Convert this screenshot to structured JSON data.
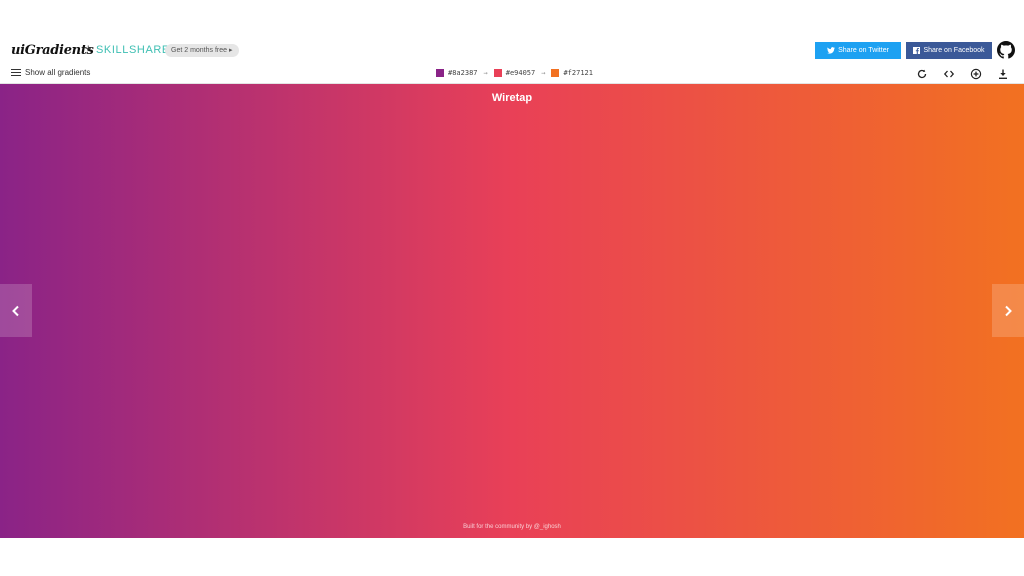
{
  "header": {
    "logo": "uiGradients",
    "plus": "+",
    "partner": "SKILLSHARE",
    "promo": "Get 2 months free",
    "twitter": "Share on Twitter",
    "facebook": "Share on Facebook"
  },
  "toolbar": {
    "show_all": "Show all gradients",
    "colors": [
      "#8a2387",
      "#e94057",
      "#f27121"
    ],
    "arrow": "→"
  },
  "gradient": {
    "name": "Wiretap",
    "credit": "Built for the community by @_ighosh"
  },
  "icons": {
    "menu": "hamburger-icon",
    "rotate": "rotate-icon",
    "code": "code-icon",
    "add": "add-icon",
    "download": "download-icon",
    "github": "github-icon",
    "prev": "chevron-left-icon",
    "next": "chevron-right-icon"
  },
  "theme": {
    "twitter": "#1da1f2",
    "facebook": "#3b5998",
    "skillshare": "#3fbfb3"
  }
}
